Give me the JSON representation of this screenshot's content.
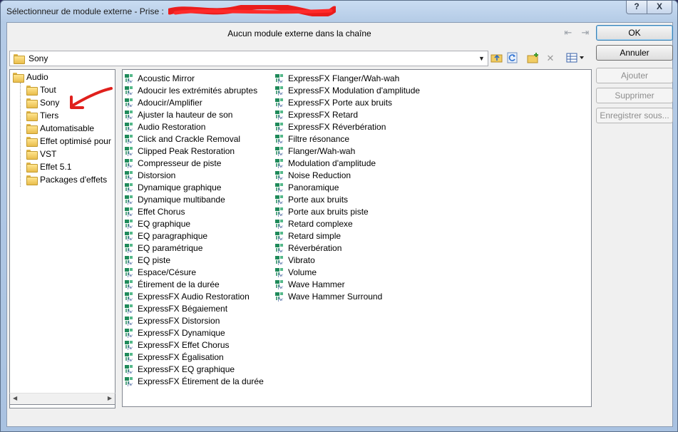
{
  "window": {
    "title": "Sélectionneur de module externe - Prise : ",
    "help_label": "?",
    "close_label": "X"
  },
  "chain": {
    "status_text": "Aucun module externe dans la chaîne"
  },
  "buttons": {
    "ok": "OK",
    "cancel": "Annuler",
    "add": "Ajouter",
    "remove": "Supprimer",
    "save_as": "Enregistrer sous..."
  },
  "path": {
    "value": "Sony"
  },
  "toolbar": {
    "icons": [
      "folder-up-icon",
      "refresh-icon",
      "new-folder-icon",
      "delete-icon",
      "view-options-icon"
    ]
  },
  "tree": {
    "root": "Audio",
    "children": [
      "Tout",
      "Sony",
      "Tiers",
      "Automatisable",
      "Effet optimisé pour",
      "VST",
      "Effet 5.1",
      "Packages d'effets"
    ],
    "selected": "Sony"
  },
  "plugins": {
    "column1": [
      "Acoustic Mirror",
      "Adoucir les extrémités abruptes",
      "Adoucir/Amplifier",
      "Ajuster la hauteur de son",
      "Audio Restoration",
      "Click and Crackle Removal",
      "Clipped Peak Restoration",
      "Compresseur de piste",
      "Distorsion",
      "Dynamique graphique",
      "Dynamique multibande",
      "Effet Chorus",
      "EQ graphique",
      "EQ paragraphique",
      "EQ paramétrique",
      "EQ piste",
      "Espace/Césure",
      "Étirement de la durée",
      "ExpressFX Audio Restoration",
      "ExpressFX Bégaiement",
      "ExpressFX Distorsion",
      "ExpressFX Dynamique",
      "ExpressFX Effet Chorus",
      "ExpressFX Égalisation",
      "ExpressFX EQ graphique",
      "ExpressFX Étirement de la durée"
    ],
    "column2": [
      "ExpressFX Flanger/Wah-wah",
      "ExpressFX Modulation d'amplitude",
      "ExpressFX Porte aux bruits",
      "ExpressFX Retard",
      "ExpressFX Réverbération",
      "Filtre résonance",
      "Flanger/Wah-wah",
      "Modulation d'amplitude",
      "Noise Reduction",
      "Panoramique",
      "Porte aux bruits",
      "Porte aux bruits piste",
      "Retard complexe",
      "Retard simple",
      "Réverbération",
      "Vibrato",
      "Volume",
      "Wave Hammer",
      "Wave Hammer Surround"
    ]
  },
  "colors": {
    "annotation_arrow": "#e0201c",
    "plugin_icon": "#1f8a5a"
  }
}
